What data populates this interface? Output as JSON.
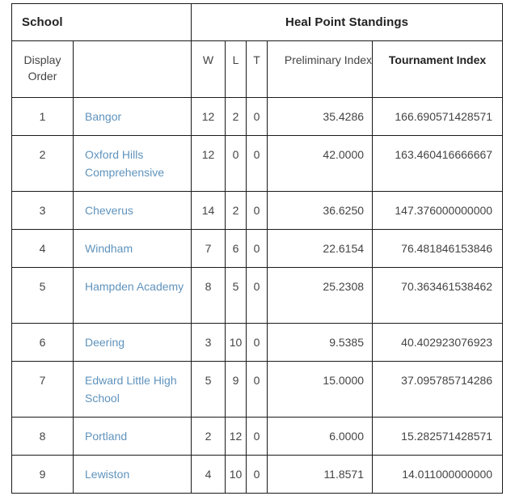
{
  "table": {
    "group_headers": {
      "school": "School",
      "heal_point_standings": "Heal Point Standings"
    },
    "columns": {
      "display_order": "Display Order",
      "school_name": "",
      "wins": "W",
      "losses": "L",
      "ties": "T",
      "preliminary_index": "Preliminary Index",
      "tournament_index": "Tournament Index"
    },
    "link_color": "#5f93bd",
    "border_color": "#1a1a1a",
    "rows": [
      {
        "display_order": "1",
        "school": "Bangor",
        "w": "12",
        "l": "2",
        "t": "0",
        "preliminary_index": "35.4286",
        "tournament_index": "166.690571428571"
      },
      {
        "display_order": "2",
        "school": "Oxford Hills Comprehensive",
        "w": "12",
        "l": "0",
        "t": "0",
        "preliminary_index": "42.0000",
        "tournament_index": "163.460416666667"
      },
      {
        "display_order": "3",
        "school": "Cheverus",
        "w": "14",
        "l": "2",
        "t": "0",
        "preliminary_index": "36.6250",
        "tournament_index": "147.376000000000"
      },
      {
        "display_order": "4",
        "school": "Windham",
        "w": "7",
        "l": "6",
        "t": "0",
        "preliminary_index": "22.6154",
        "tournament_index": "76.481846153846"
      },
      {
        "display_order": "5",
        "school": "Hampden Academy",
        "w": "8",
        "l": "5",
        "t": "0",
        "preliminary_index": "25.2308",
        "tournament_index": "70.363461538462"
      },
      {
        "display_order": "6",
        "school": "Deering",
        "w": "3",
        "l": "10",
        "t": "0",
        "preliminary_index": "9.5385",
        "tournament_index": "40.402923076923"
      },
      {
        "display_order": "7",
        "school": "Edward Little High School",
        "w": "5",
        "l": "9",
        "t": "0",
        "preliminary_index": "15.0000",
        "tournament_index": "37.095785714286"
      },
      {
        "display_order": "8",
        "school": "Portland",
        "w": "2",
        "l": "12",
        "t": "0",
        "preliminary_index": "6.0000",
        "tournament_index": "15.282571428571"
      },
      {
        "display_order": "9",
        "school": "Lewiston",
        "w": "4",
        "l": "10",
        "t": "0",
        "preliminary_index": "11.8571",
        "tournament_index": "14.011000000000"
      }
    ]
  }
}
